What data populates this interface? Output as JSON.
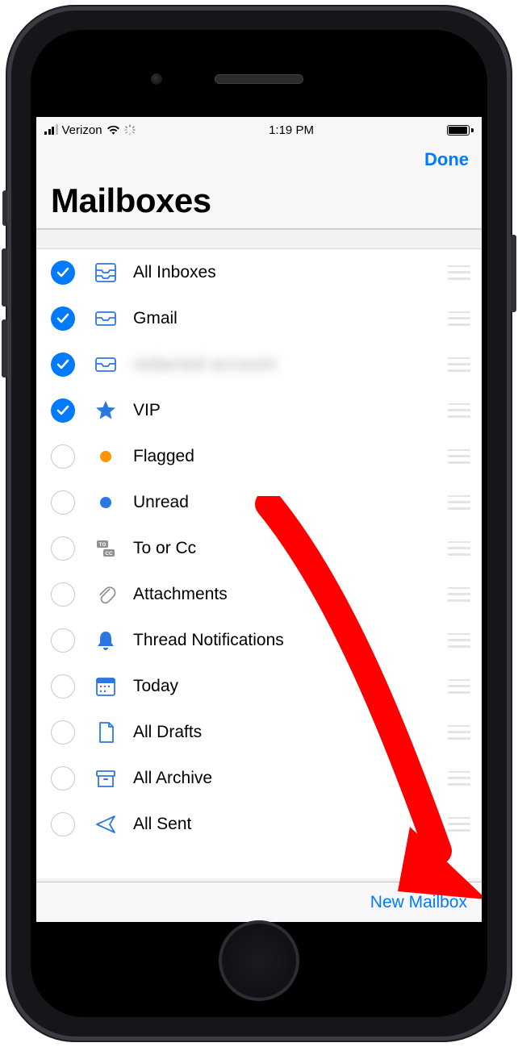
{
  "status_bar": {
    "carrier": "Verizon",
    "time": "1:19 PM"
  },
  "nav": {
    "done_label": "Done",
    "title": "Mailboxes"
  },
  "mailboxes": [
    {
      "label": "All Inboxes",
      "checked": true,
      "icon": "tray-2",
      "blurred": false
    },
    {
      "label": "Gmail",
      "checked": true,
      "icon": "tray",
      "blurred": false
    },
    {
      "label": "redacted account",
      "checked": true,
      "icon": "tray",
      "blurred": true
    },
    {
      "label": "VIP",
      "checked": true,
      "icon": "star",
      "blurred": false
    },
    {
      "label": "Flagged",
      "checked": false,
      "icon": "dot-orange",
      "blurred": false
    },
    {
      "label": "Unread",
      "checked": false,
      "icon": "dot-blue",
      "blurred": false
    },
    {
      "label": "To or Cc",
      "checked": false,
      "icon": "to-cc",
      "blurred": false
    },
    {
      "label": "Attachments",
      "checked": false,
      "icon": "paperclip",
      "blurred": false
    },
    {
      "label": "Thread Notifications",
      "checked": false,
      "icon": "bell",
      "blurred": false
    },
    {
      "label": "Today",
      "checked": false,
      "icon": "calendar",
      "blurred": false
    },
    {
      "label": "All Drafts",
      "checked": false,
      "icon": "doc",
      "blurred": false
    },
    {
      "label": "All Archive",
      "checked": false,
      "icon": "archive",
      "blurred": false
    },
    {
      "label": "All Sent",
      "checked": false,
      "icon": "send",
      "blurred": false
    }
  ],
  "toolbar": {
    "new_mailbox_label": "New Mailbox"
  },
  "colors": {
    "accent": "#007aff",
    "orange": "#ff9500",
    "annotation": "#ff0000"
  }
}
